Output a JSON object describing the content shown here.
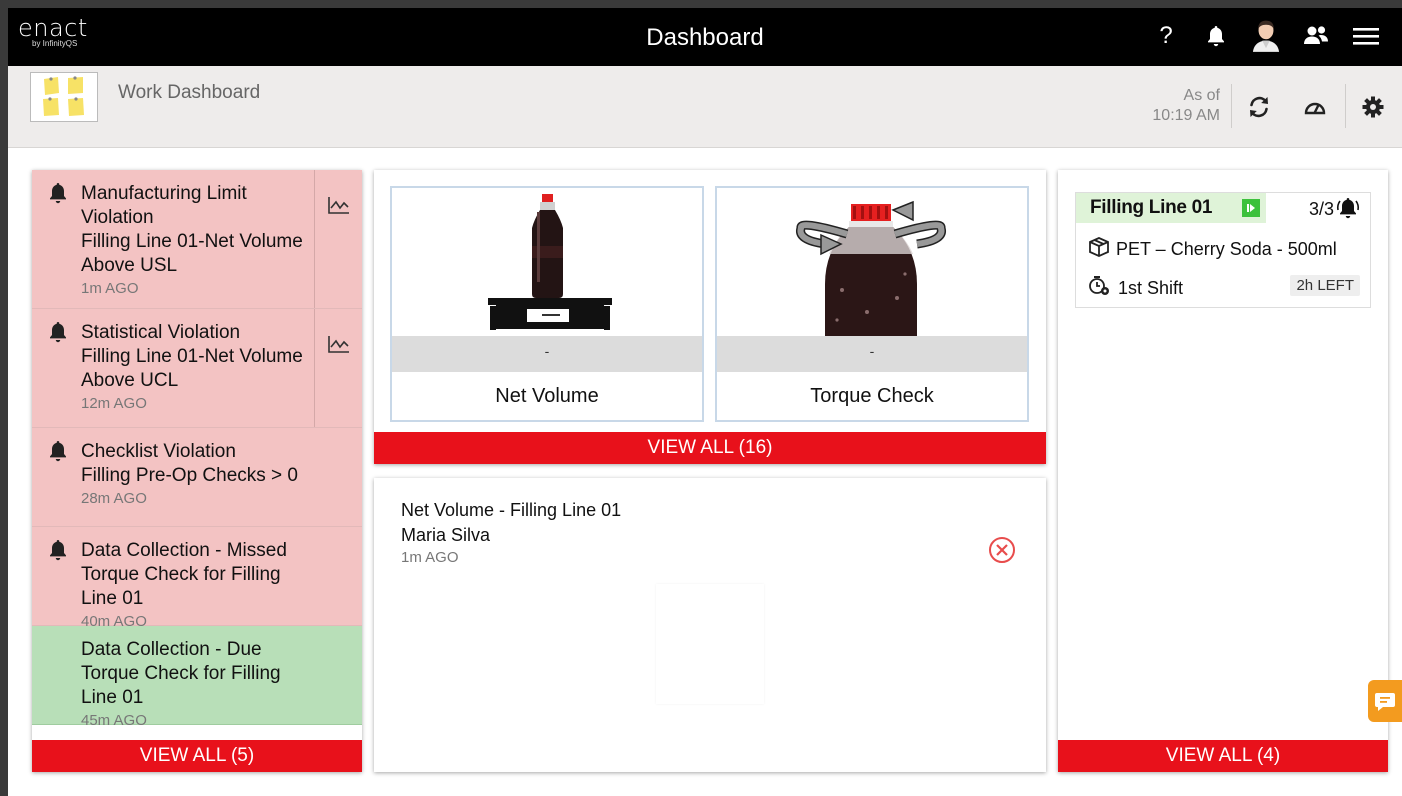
{
  "app": {
    "logo_main": "enact",
    "logo_sub": "by InfinityQS",
    "title": "Dashboard",
    "help_label": "?"
  },
  "subheader": {
    "title": "Work Dashboard",
    "as_of_label": "As of",
    "as_of_time": "10:19 AM"
  },
  "alerts": {
    "items": [
      {
        "title": "Manufacturing Limit Violation",
        "detail": "Filling Line 01-Net Volume Above USL",
        "ago": "1m AGO",
        "status": "red"
      },
      {
        "title": "Statistical Violation",
        "detail": "Filling Line 01-Net Volume Above UCL",
        "ago": "12m AGO",
        "status": "red"
      },
      {
        "title": "Checklist Violation",
        "detail": "Filling Pre-Op Checks > 0",
        "ago": "28m AGO",
        "status": "red"
      },
      {
        "title": "Data Collection - Missed",
        "detail": "Torque Check for Filling Line 01",
        "ago": "40m AGO",
        "status": "red"
      },
      {
        "title": "Data Collection - Due",
        "detail": "Torque Check for Filling Line 01",
        "ago": "45m AGO",
        "status": "green"
      }
    ],
    "view_all": "VIEW ALL  (5)"
  },
  "tiles": {
    "items": [
      {
        "label": "Net Volume",
        "value": "-"
      },
      {
        "label": "Torque Check",
        "value": "-"
      }
    ],
    "view_all": "VIEW ALL  (16)"
  },
  "note": {
    "title": "Net Volume - Filling Line 01",
    "user": "Maria Silva",
    "ago": "1m AGO"
  },
  "lines": {
    "card": {
      "name": "Filling Line 01",
      "count": "3/3",
      "product": "PET – Cherry Soda - 500ml",
      "shift": "1st Shift",
      "time_left": "2h LEFT"
    },
    "view_all": "VIEW ALL  (4)"
  },
  "colors": {
    "accent_red": "#e8111b",
    "alert_red_bg": "#f3c3c3",
    "alert_green_bg": "#b8dfb8",
    "running_green": "#3cc13c",
    "chat_orange": "#f39b1f"
  }
}
